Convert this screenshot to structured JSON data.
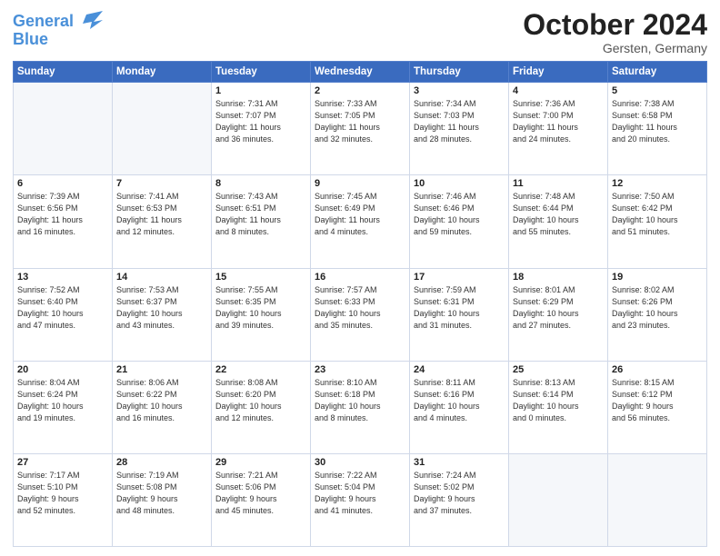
{
  "header": {
    "logo_line1": "General",
    "logo_line2": "Blue",
    "month": "October 2024",
    "location": "Gersten, Germany"
  },
  "weekdays": [
    "Sunday",
    "Monday",
    "Tuesday",
    "Wednesday",
    "Thursday",
    "Friday",
    "Saturday"
  ],
  "weeks": [
    [
      {
        "day": "",
        "info": ""
      },
      {
        "day": "",
        "info": ""
      },
      {
        "day": "1",
        "info": "Sunrise: 7:31 AM\nSunset: 7:07 PM\nDaylight: 11 hours\nand 36 minutes."
      },
      {
        "day": "2",
        "info": "Sunrise: 7:33 AM\nSunset: 7:05 PM\nDaylight: 11 hours\nand 32 minutes."
      },
      {
        "day": "3",
        "info": "Sunrise: 7:34 AM\nSunset: 7:03 PM\nDaylight: 11 hours\nand 28 minutes."
      },
      {
        "day": "4",
        "info": "Sunrise: 7:36 AM\nSunset: 7:00 PM\nDaylight: 11 hours\nand 24 minutes."
      },
      {
        "day": "5",
        "info": "Sunrise: 7:38 AM\nSunset: 6:58 PM\nDaylight: 11 hours\nand 20 minutes."
      }
    ],
    [
      {
        "day": "6",
        "info": "Sunrise: 7:39 AM\nSunset: 6:56 PM\nDaylight: 11 hours\nand 16 minutes."
      },
      {
        "day": "7",
        "info": "Sunrise: 7:41 AM\nSunset: 6:53 PM\nDaylight: 11 hours\nand 12 minutes."
      },
      {
        "day": "8",
        "info": "Sunrise: 7:43 AM\nSunset: 6:51 PM\nDaylight: 11 hours\nand 8 minutes."
      },
      {
        "day": "9",
        "info": "Sunrise: 7:45 AM\nSunset: 6:49 PM\nDaylight: 11 hours\nand 4 minutes."
      },
      {
        "day": "10",
        "info": "Sunrise: 7:46 AM\nSunset: 6:46 PM\nDaylight: 10 hours\nand 59 minutes."
      },
      {
        "day": "11",
        "info": "Sunrise: 7:48 AM\nSunset: 6:44 PM\nDaylight: 10 hours\nand 55 minutes."
      },
      {
        "day": "12",
        "info": "Sunrise: 7:50 AM\nSunset: 6:42 PM\nDaylight: 10 hours\nand 51 minutes."
      }
    ],
    [
      {
        "day": "13",
        "info": "Sunrise: 7:52 AM\nSunset: 6:40 PM\nDaylight: 10 hours\nand 47 minutes."
      },
      {
        "day": "14",
        "info": "Sunrise: 7:53 AM\nSunset: 6:37 PM\nDaylight: 10 hours\nand 43 minutes."
      },
      {
        "day": "15",
        "info": "Sunrise: 7:55 AM\nSunset: 6:35 PM\nDaylight: 10 hours\nand 39 minutes."
      },
      {
        "day": "16",
        "info": "Sunrise: 7:57 AM\nSunset: 6:33 PM\nDaylight: 10 hours\nand 35 minutes."
      },
      {
        "day": "17",
        "info": "Sunrise: 7:59 AM\nSunset: 6:31 PM\nDaylight: 10 hours\nand 31 minutes."
      },
      {
        "day": "18",
        "info": "Sunrise: 8:01 AM\nSunset: 6:29 PM\nDaylight: 10 hours\nand 27 minutes."
      },
      {
        "day": "19",
        "info": "Sunrise: 8:02 AM\nSunset: 6:26 PM\nDaylight: 10 hours\nand 23 minutes."
      }
    ],
    [
      {
        "day": "20",
        "info": "Sunrise: 8:04 AM\nSunset: 6:24 PM\nDaylight: 10 hours\nand 19 minutes."
      },
      {
        "day": "21",
        "info": "Sunrise: 8:06 AM\nSunset: 6:22 PM\nDaylight: 10 hours\nand 16 minutes."
      },
      {
        "day": "22",
        "info": "Sunrise: 8:08 AM\nSunset: 6:20 PM\nDaylight: 10 hours\nand 12 minutes."
      },
      {
        "day": "23",
        "info": "Sunrise: 8:10 AM\nSunset: 6:18 PM\nDaylight: 10 hours\nand 8 minutes."
      },
      {
        "day": "24",
        "info": "Sunrise: 8:11 AM\nSunset: 6:16 PM\nDaylight: 10 hours\nand 4 minutes."
      },
      {
        "day": "25",
        "info": "Sunrise: 8:13 AM\nSunset: 6:14 PM\nDaylight: 10 hours\nand 0 minutes."
      },
      {
        "day": "26",
        "info": "Sunrise: 8:15 AM\nSunset: 6:12 PM\nDaylight: 9 hours\nand 56 minutes."
      }
    ],
    [
      {
        "day": "27",
        "info": "Sunrise: 7:17 AM\nSunset: 5:10 PM\nDaylight: 9 hours\nand 52 minutes."
      },
      {
        "day": "28",
        "info": "Sunrise: 7:19 AM\nSunset: 5:08 PM\nDaylight: 9 hours\nand 48 minutes."
      },
      {
        "day": "29",
        "info": "Sunrise: 7:21 AM\nSunset: 5:06 PM\nDaylight: 9 hours\nand 45 minutes."
      },
      {
        "day": "30",
        "info": "Sunrise: 7:22 AM\nSunset: 5:04 PM\nDaylight: 9 hours\nand 41 minutes."
      },
      {
        "day": "31",
        "info": "Sunrise: 7:24 AM\nSunset: 5:02 PM\nDaylight: 9 hours\nand 37 minutes."
      },
      {
        "day": "",
        "info": ""
      },
      {
        "day": "",
        "info": ""
      }
    ]
  ]
}
